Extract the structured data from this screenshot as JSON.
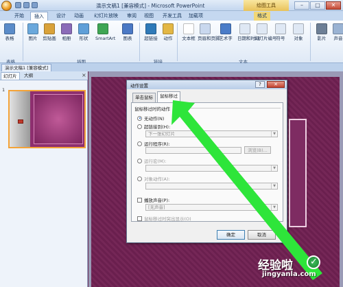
{
  "titlebar": {
    "title": "演示文稿1 [兼容模式] - Microsoft PowerPoint",
    "context_tools": "绘图工具",
    "minimize": "–",
    "maximize": "□",
    "close": "✕"
  },
  "tabs": [
    "开始",
    "插入",
    "设计",
    "动画",
    "幻灯片放映",
    "审阅",
    "视图",
    "开发工具",
    "加载项",
    "格式"
  ],
  "active_tab": "插入",
  "ribbon": {
    "buttons": [
      {
        "label": "表格",
        "icon": "table-icon",
        "color": "#5b8cc9"
      },
      {
        "label": "图片",
        "icon": "picture-icon",
        "color": "#6aa8dc"
      },
      {
        "label": "剪贴画",
        "icon": "clipart-icon",
        "color": "#d9a23a"
      },
      {
        "label": "相册",
        "icon": "album-icon",
        "color": "#8a6bb8"
      },
      {
        "label": "形状",
        "icon": "shapes-icon",
        "color": "#5f9fd8"
      },
      {
        "label": "SmartArt",
        "icon": "smartart-icon",
        "color": "#3fa654"
      },
      {
        "label": "图表",
        "icon": "chart-icon",
        "color": "#4b79c5"
      },
      {
        "label": "超链接",
        "icon": "hyperlink-icon",
        "color": "#2f7ab8"
      },
      {
        "label": "动作",
        "icon": "action-icon",
        "color": "#e3b744"
      },
      {
        "label": "文本框",
        "icon": "textbox-icon",
        "color": "#ffffff"
      },
      {
        "label": "页眉和页脚",
        "icon": "header-footer-icon",
        "color": "#c9d8ee"
      },
      {
        "label": "艺术字",
        "icon": "wordart-icon",
        "color": "#4a7cc8"
      },
      {
        "label": "日期和时间",
        "icon": "datetime-icon",
        "color": "#dfe8f4"
      },
      {
        "label": "幻灯片编号",
        "icon": "slide-number-icon",
        "color": "#dfe8f4"
      },
      {
        "label": "符号",
        "icon": "symbol-icon",
        "color": "#dfe8f4"
      },
      {
        "label": "对象",
        "icon": "object-icon",
        "color": "#dfe8f4"
      },
      {
        "label": "影片",
        "icon": "movie-icon",
        "color": "#6d7f96"
      },
      {
        "label": "声音",
        "icon": "sound-icon",
        "color": "#9ab3d3"
      }
    ],
    "group_labels": [
      "表格",
      "插图",
      "链接",
      "文本"
    ]
  },
  "document_tab": "演示文稿1 [兼容模式]",
  "left_pane": {
    "tabs": [
      "幻灯片",
      "大纲"
    ],
    "close": "×",
    "slide_number": "1"
  },
  "dialog": {
    "title": "动作设置",
    "help": "?",
    "close": "✕",
    "tabs": [
      "单击鼠标",
      "鼠标移过"
    ],
    "active_tab": "鼠标移过",
    "group_title": "鼠标移过时的动作",
    "options": {
      "none": "无动作(N)",
      "hyperlink": "超链接到(H):",
      "hyperlink_target": "下一张幻灯片",
      "run_program": "运行程序(R):",
      "browse": "浏览(B)...",
      "run_macro": "运行宏(M):",
      "object_action": "对象动作(A):",
      "play_sound": "播放声音(P):",
      "sound_value": "[无声音]",
      "highlight": "鼠标移过时突出显示(O)"
    },
    "ok": "确定",
    "cancel": "取消"
  },
  "watermark": {
    "text": "经验啦",
    "check": "✓",
    "url": "jingyanla.com"
  },
  "colors": {
    "arrow": "#2ee53a",
    "slide_bg": "#6a1f4e",
    "ribbon_bg": "#dfe9f6"
  }
}
